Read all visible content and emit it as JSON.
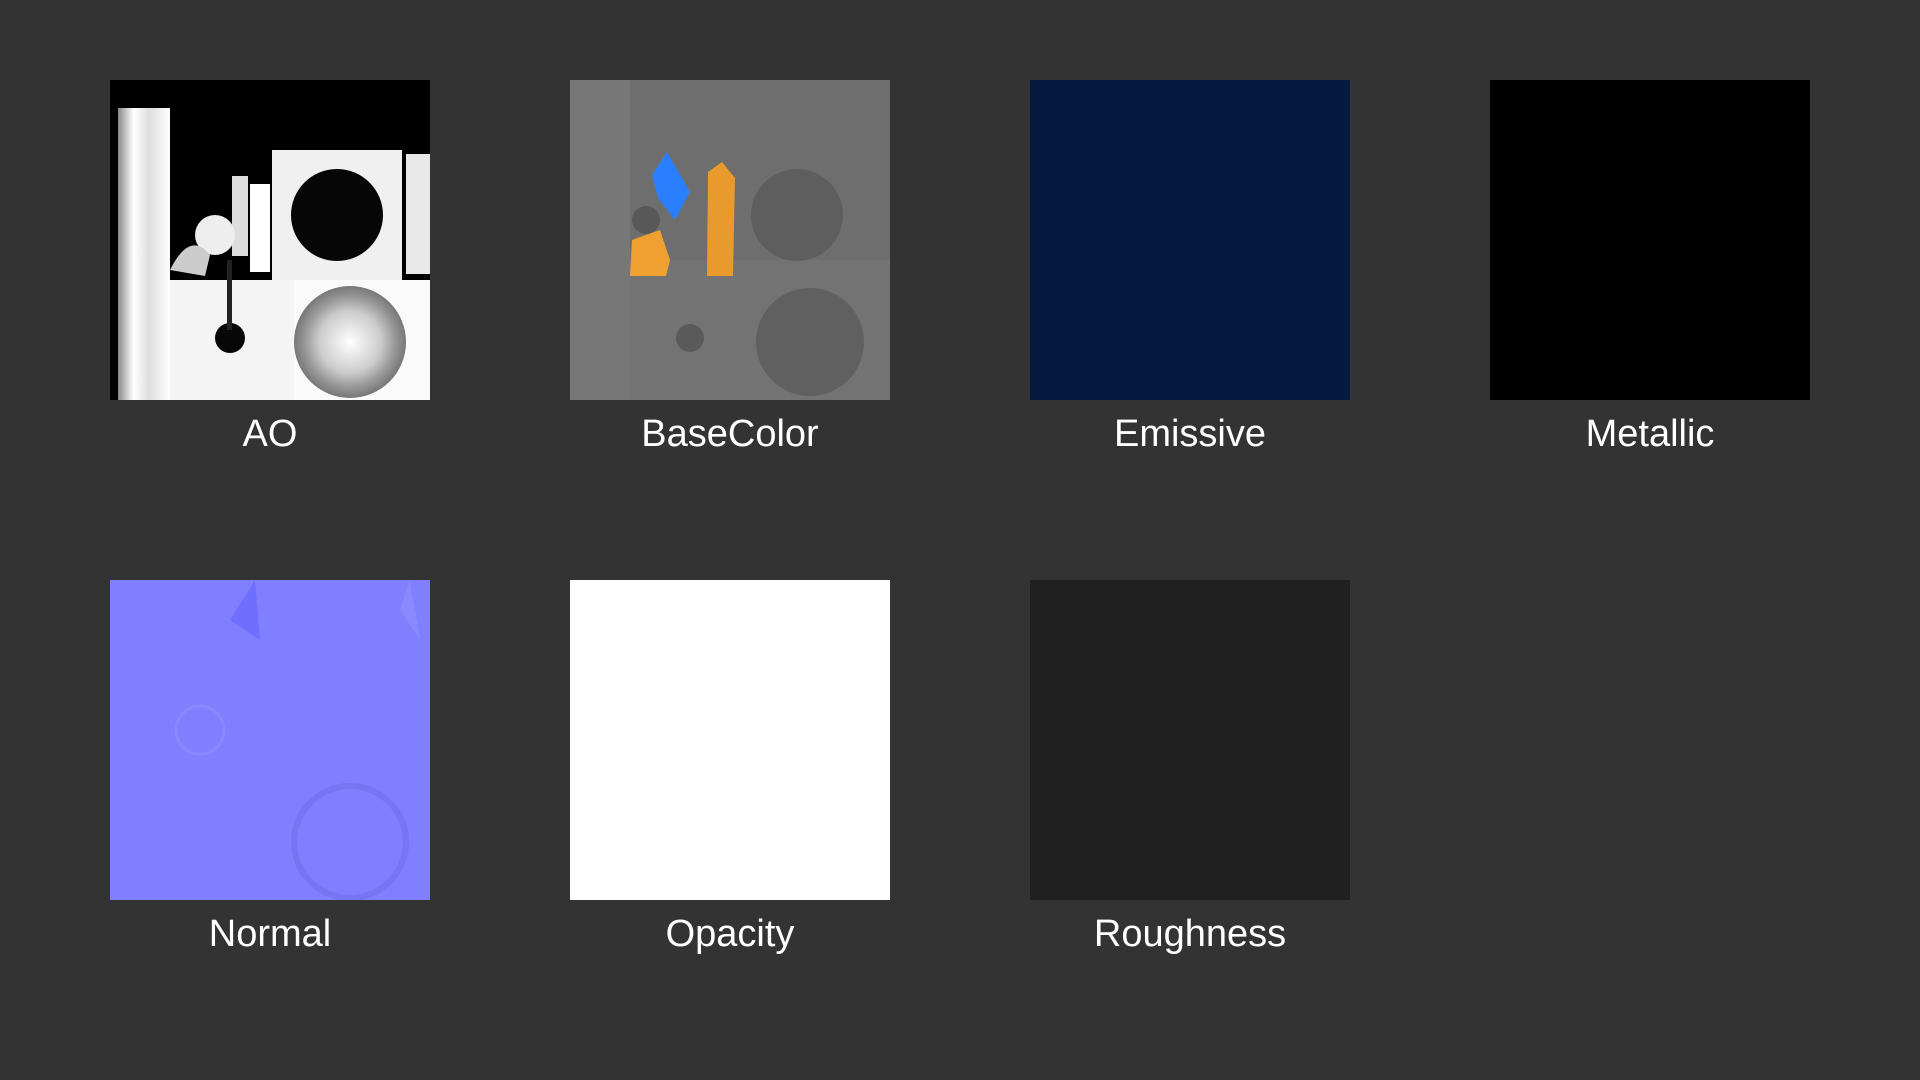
{
  "textures": [
    {
      "label": "AO",
      "color": "#000000"
    },
    {
      "label": "BaseColor",
      "color": "#6b6b6b"
    },
    {
      "label": "Emissive",
      "color": "#041a3e"
    },
    {
      "label": "Metallic",
      "color": "#000000"
    },
    {
      "label": "Normal",
      "color": "#7f7fff"
    },
    {
      "label": "Opacity",
      "color": "#ffffff"
    },
    {
      "label": "Roughness",
      "color": "#202020"
    }
  ],
  "colors": {
    "background": "#333333",
    "label": "#ffffff",
    "accent_blue": "#2a7fff",
    "accent_orange": "#f0a030"
  }
}
